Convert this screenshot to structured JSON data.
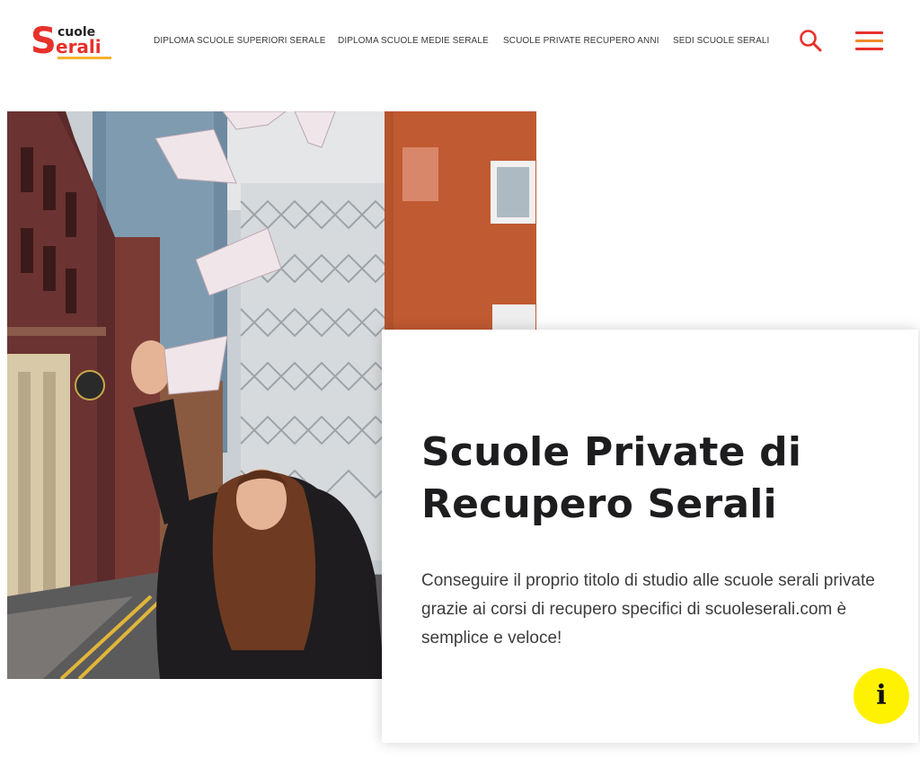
{
  "logo": {
    "letter": "S",
    "top": "cuole",
    "bottom": "erali"
  },
  "nav": [
    {
      "label": "DIPLOMA SCUOLE SUPERIORI SERALE"
    },
    {
      "label": "DIPLOMA SCUOLE MEDIE SERALE"
    },
    {
      "label": "SCUOLE PRIVATE RECUPERO ANNI"
    },
    {
      "label": "SEDI SCUOLE SERALI"
    }
  ],
  "icons": {
    "search": "search-icon",
    "menu": "hamburger-menu-icon",
    "info": "info-icon"
  },
  "colors": {
    "brand_red": "#e7312b",
    "brand_orange": "#f4b230",
    "info_yellow": "#fff200",
    "heading": "#1d1d1f"
  },
  "hero": {
    "title": "Scuole Private di Recupero Serali",
    "description": "Conseguire il proprio titolo di studio alle scuole serali private grazie ai corsi di recupero specifici di scuoleserali.com è semplice e veloce!"
  },
  "info_button": {
    "glyph": "i"
  }
}
